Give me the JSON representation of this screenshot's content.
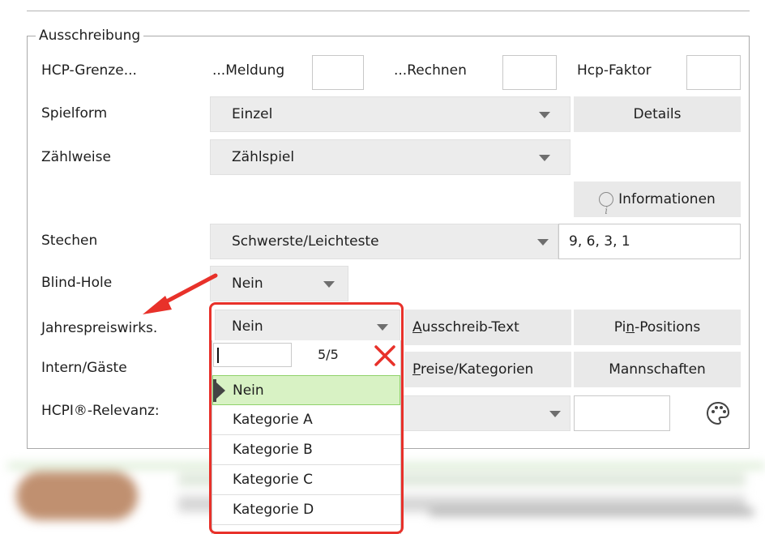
{
  "section": {
    "legend": "Ausschreibung"
  },
  "hcp": {
    "label": "HCP-Grenze...",
    "meldung_label": "...Meldung",
    "meldung_value": "",
    "rechnen_label": "...Rechnen",
    "rechnen_value": "",
    "faktor_label": "Hcp-Faktor",
    "faktor_value": ""
  },
  "spielform": {
    "label": "Spielform",
    "value": "Einzel",
    "details_button": "Details"
  },
  "zaehlweise": {
    "label": "Zählweise",
    "value": "Zählspiel"
  },
  "informationen_button": "Informationen",
  "stechen": {
    "label": "Stechen",
    "value": "Schwerste/Leichteste",
    "holes": "9, 6, 3, 1"
  },
  "blind_hole": {
    "label": "Blind-Hole",
    "value": "Nein"
  },
  "jahrespreis": {
    "label": "Jahrespreiswirks.",
    "value": "Nein"
  },
  "intern_gaeste": {
    "label": "Intern/Gäste"
  },
  "hcpi": {
    "label": "HCPI®-Relevanz:",
    "value": "",
    "extra_value": ""
  },
  "buttons": {
    "ausschreib_text_u": "A",
    "ausschreib_text_rest": "usschreib-Text",
    "pin_positions_pre": "Pi",
    "pin_positions_u": "n",
    "pin_positions_post": "-Positions",
    "preise_u": "P",
    "preise_rest": "reise/Kategorien",
    "mannschaften": "Mannschaften"
  },
  "dropdown": {
    "search_value": "",
    "count": "5/5",
    "options": [
      "Nein",
      "Kategorie A",
      "Kategorie B",
      "Kategorie C",
      "Kategorie D"
    ],
    "selected": "Nein"
  },
  "colors": {
    "highlight_border": "#e8312a",
    "arrow": "#e8312a",
    "selected_bg": "#d8f2c4",
    "control_bg": "#ececec"
  },
  "icons": [
    "info-icon",
    "palette-icon",
    "clear-x-icon",
    "dropdown-caret-icon",
    "annotation-arrow"
  ]
}
